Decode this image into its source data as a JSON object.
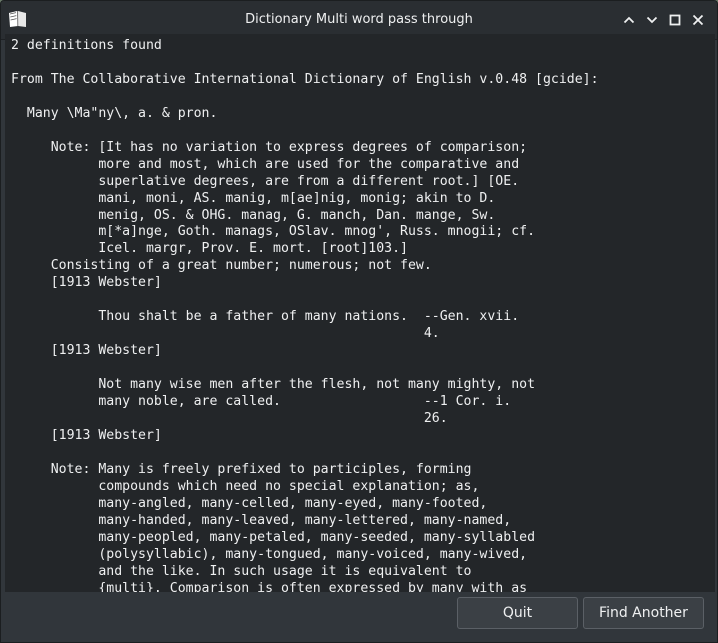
{
  "window": {
    "title": "Dictionary Multi word pass through"
  },
  "content": {
    "lines": [
      "2 definitions found",
      "",
      "From The Collaborative International Dictionary of English v.0.48 [gcide]:",
      "",
      "  Many \\Ma\"ny\\, a. & pron.",
      "",
      "     Note: [It has no variation to express degrees of comparison;",
      "           more and most, which are used for the comparative and",
      "           superlative degrees, are from a different root.] [OE.",
      "           mani, moni, AS. manig, m[ae]nig, monig; akin to D.",
      "           menig, OS. & OHG. manag, G. manch, Dan. mange, Sw.",
      "           m[*a]nge, Goth. manags, OSlav. mnog', Russ. mnogii; cf.",
      "           Icel. margr, Prov. E. mort. [root]103.]",
      "     Consisting of a great number; numerous; not few.",
      "     [1913 Webster]",
      "",
      "           Thou shalt be a father of many nations.  --Gen. xvii.",
      "                                                    4.",
      "     [1913 Webster]",
      "",
      "           Not many wise men after the flesh, not many mighty, not",
      "           many noble, are called.                  --1 Cor. i.",
      "                                                    26.",
      "     [1913 Webster]",
      "",
      "     Note: Many is freely prefixed to participles, forming",
      "           compounds which need no special explanation; as,",
      "           many-angled, many-celled, many-eyed, many-footed,",
      "           many-handed, many-leaved, many-lettered, many-named,",
      "           many-peopled, many-petaled, many-seeded, many-syllabled",
      "           (polysyllabic), many-tongued, many-voiced, many-wived,",
      "           and the like. In such usage it is equivalent to",
      "           {multi}. Comparison is often expressed by many with as"
    ]
  },
  "buttons": {
    "quit": "Quit",
    "find_another": "Find Another"
  },
  "icons": {
    "app": "book-icon",
    "keep_above": "chevron-up-icon",
    "minimize": "chevron-down-icon",
    "maximize": "maximize-icon",
    "close": "close-icon"
  },
  "colors": {
    "window_bg": "#31363b",
    "text_area_bg": "#232629",
    "text": "#eff0f1"
  }
}
